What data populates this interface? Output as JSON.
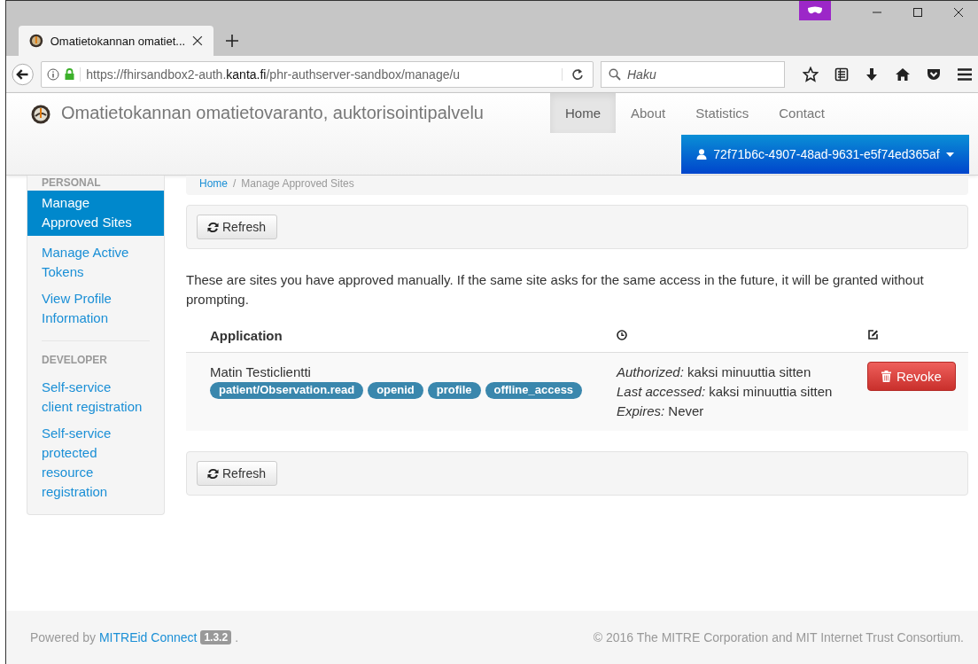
{
  "browser": {
    "tab_title": "Omatietokannan omatiet...",
    "url": {
      "prefix": "https://fhirsandbox2-auth.",
      "domain": "kanta.fi",
      "path": "/phr-authserver-sandbox/manage/u"
    },
    "search": {
      "placeholder": "Haku"
    }
  },
  "navbar": {
    "brand": "Omatietokannan omatietovaranto, auktorisointipalvelu",
    "items": [
      {
        "label": "Home",
        "selected": true
      },
      {
        "label": "About",
        "selected": false
      },
      {
        "label": "Statistics",
        "selected": false
      },
      {
        "label": "Contact",
        "selected": false
      }
    ],
    "user": "72f71b6c-4907-48ad-9631-e5f74ed365af"
  },
  "sidebar": {
    "sections": [
      {
        "heading": "PERSONAL",
        "items": [
          {
            "label": "Manage Approved Sites",
            "selected": true
          },
          {
            "label": "Manage Active Tokens",
            "selected": false
          },
          {
            "label": "View Profile Information",
            "selected": false
          }
        ]
      },
      {
        "heading": "DEVELOPER",
        "items": [
          {
            "label": "Self-service client registration",
            "selected": false
          },
          {
            "label": "Self-service protected resource registration",
            "selected": false
          }
        ]
      }
    ]
  },
  "breadcrumb": {
    "items": [
      "Home",
      "Manage Approved Sites"
    ],
    "separator": "/"
  },
  "toolbars": [
    {
      "button": "Refresh"
    },
    {
      "button": "Refresh"
    }
  ],
  "intro": "These are sites you have approved manually. If the same site asks for the same access in the future, it will be granted without prompting.",
  "table": {
    "columns": [
      {
        "kind": "text",
        "label": "Application"
      },
      {
        "kind": "clock"
      },
      {
        "kind": "edit"
      }
    ],
    "rows": [
      {
        "name": "Matin Testiclientti",
        "scopes": [
          "patient/Observation.read",
          "openid",
          "profile",
          "offline_access"
        ],
        "details": [
          {
            "label": "Authorized:",
            "value": "kaksi minuuttia sitten"
          },
          {
            "label": "Last accessed:",
            "value": "kaksi minuuttia sitten"
          },
          {
            "label": "Expires:",
            "value": "Never"
          }
        ],
        "action": "Revoke"
      }
    ]
  },
  "footer": {
    "powered_by": "Powered by",
    "link": "MITREid Connect",
    "version": "1.3.2",
    "trailing": ".",
    "copyright": "© 2016 The MITRE Corporation and MIT Internet Trust Consortium."
  }
}
